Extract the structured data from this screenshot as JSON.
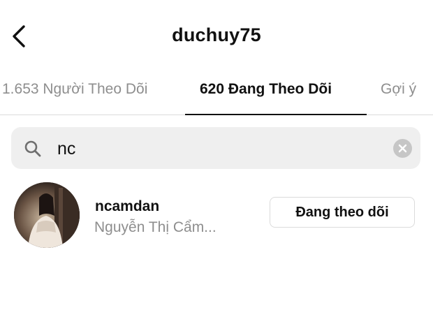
{
  "header": {
    "back_icon": "chevron-left-icon",
    "title": "duchuy75"
  },
  "tabs": [
    {
      "label": "1.653 Người Theo Dõi",
      "active": false
    },
    {
      "label": "620 Đang Theo Dõi",
      "active": true
    },
    {
      "label": "Gợi ý",
      "active": false
    }
  ],
  "search": {
    "icon": "search-icon",
    "value": "nc",
    "clear_icon": "clear-icon"
  },
  "results": [
    {
      "username": "ncamdan",
      "full_name": "Nguyễn Thị Cẩm...",
      "button_label": "Đang theo dõi"
    }
  ],
  "colors": {
    "text": "#111111",
    "muted": "#8e8e8e",
    "search_bg": "#efefef",
    "divider": "#dbdbdb"
  }
}
